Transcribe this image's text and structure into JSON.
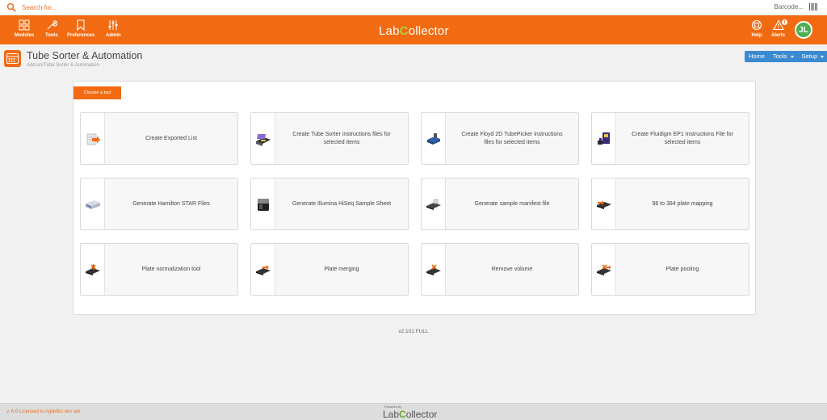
{
  "search": {
    "placeholder": "Search for...",
    "barcode_placeholder": "Barcode..."
  },
  "nav": {
    "modules": "Modules",
    "tools": "Tools",
    "preferences": "Preferences",
    "admin": "Admin",
    "help": "Help",
    "alerts": "Alerts",
    "alerts_count": "1"
  },
  "logo": {
    "part1": "Lab",
    "part2": "C",
    "part3": "ollector"
  },
  "user": {
    "initials": "JL"
  },
  "page": {
    "title": "Tube Sorter & Automation",
    "breadcrumb": "Add-on/Tube Sorter & Automation"
  },
  "topbuttons": {
    "home": "Home",
    "tools": "Tools",
    "setup": "Setup"
  },
  "panel": {
    "choose_label": "Choose a tool"
  },
  "tools": [
    {
      "label": "Create Exported List",
      "icon": "export-list-icon"
    },
    {
      "label": "Create Tube Sorter instructions files for selected items",
      "icon": "tube-sorter-icon"
    },
    {
      "label": "Create Floyd 2D TubePicker instructions files for selected items",
      "icon": "tubepicker-icon"
    },
    {
      "label": "Create Fluidigm EP1 Instructions File for selected items",
      "icon": "fluidigm-icon"
    },
    {
      "label": "Generate Hamilton STAR Files",
      "icon": "hamilton-icon"
    },
    {
      "label": "Generate Illumina HiSeq Sample Sheet",
      "icon": "illumina-icon"
    },
    {
      "label": "Generate sample manifest file",
      "icon": "manifest-icon"
    },
    {
      "label": "96 to 384 plate mapping",
      "icon": "plate-mapping-icon"
    },
    {
      "label": "Plate normalization tool",
      "icon": "plate-normalization-icon"
    },
    {
      "label": "Plate merging",
      "icon": "plate-merging-icon"
    },
    {
      "label": "Remove volume",
      "icon": "remove-volume-icon"
    },
    {
      "label": "Plate pooling",
      "icon": "plate-pooling-icon"
    }
  ],
  "version": "v2.101 FULL",
  "footer": {
    "license": "v. 6.0 Licensed to AgileBio dev lab",
    "powered": "Powered by",
    "logo_part1": "Lab",
    "logo_part2": "C",
    "logo_part3": "ollector"
  },
  "colors": {
    "brand": "#f26b12",
    "accent_green": "#a6d33e",
    "button_blue": "#3a8ad2"
  }
}
